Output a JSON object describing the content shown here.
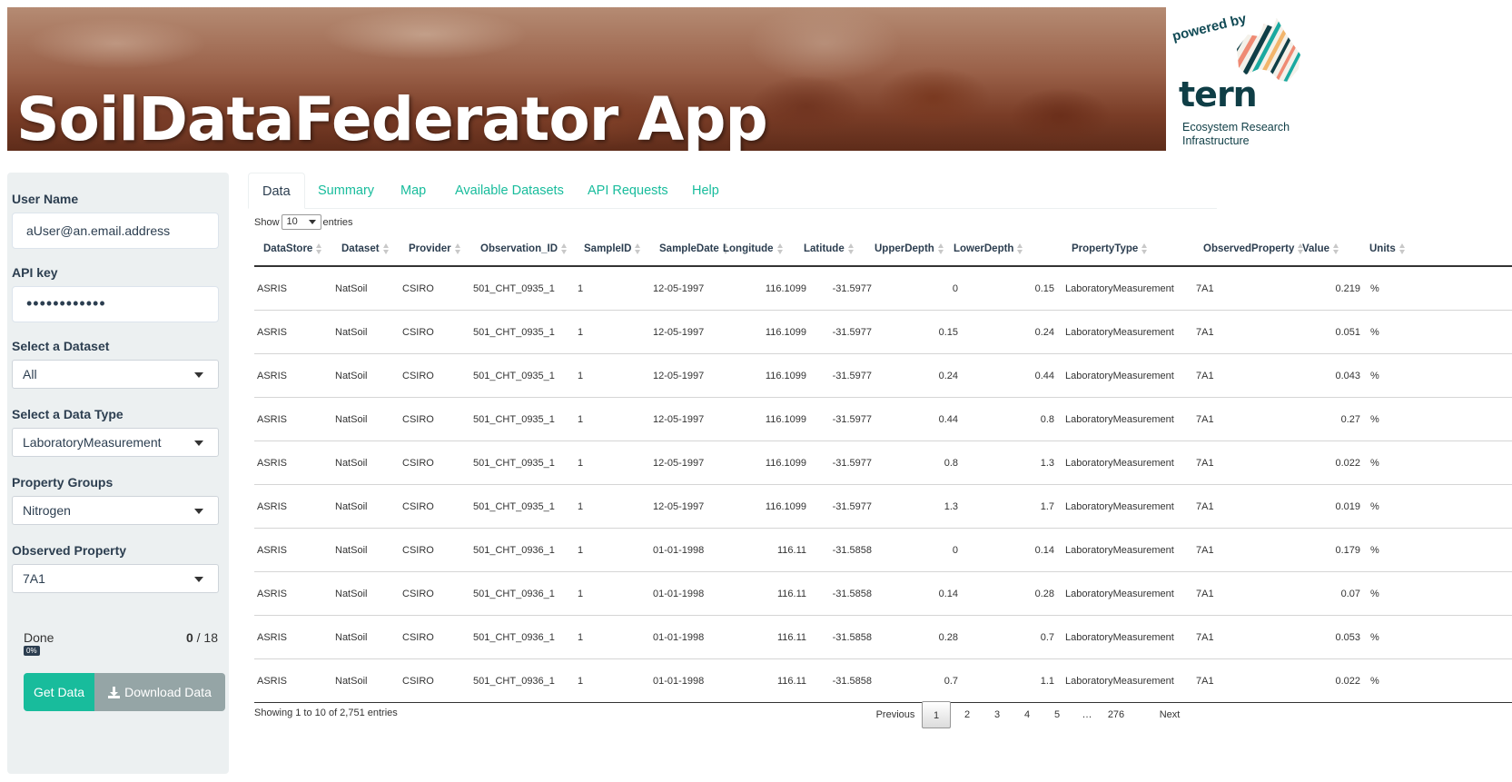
{
  "header": {
    "title": "SoilDataFederator App",
    "logo": {
      "powered_by": "powered by",
      "name": "tern",
      "subtitle_line1": "Ecosystem Research",
      "subtitle_line2": "Infrastructure"
    }
  },
  "sidebar": {
    "username_label": "User Name",
    "username_value": "aUser@an.email.address",
    "apikey_label": "API key",
    "apikey_masked": "••••••••••••",
    "dataset_label": "Select a Dataset",
    "dataset_value": "All",
    "datatype_label": "Select a Data Type",
    "datatype_value": "LaboratoryMeasurement",
    "propgroups_label": "Property Groups",
    "propgroups_value": "Nitrogen",
    "observed_label": "Observed Property",
    "observed_value": "7A1",
    "progress": {
      "label": "Done",
      "done": "0",
      "total": "/ 18",
      "percent": "0%"
    },
    "get_data_label": "Get Data",
    "download_label": "Download Data"
  },
  "tabs": [
    "Data",
    "Summary",
    "Map",
    "Available Datasets",
    "API Requests",
    "Help"
  ],
  "table_controls": {
    "show": "Show",
    "length": "10",
    "entries": "entries"
  },
  "table": {
    "columns": [
      "DataStore",
      "Dataset",
      "Provider",
      "Observation_ID",
      "SampleID",
      "SampleDate",
      "Longitude",
      "Latitude",
      "UpperDepth",
      "LowerDepth",
      "PropertyType",
      "ObservedProperty",
      "Value",
      "Units"
    ],
    "rows": [
      [
        "ASRIS",
        "NatSoil",
        "CSIRO",
        "501_CHT_0935_1",
        "1",
        "12-05-1997",
        "116.1099",
        "-31.5977",
        "0",
        "0.15",
        "LaboratoryMeasurement",
        "7A1",
        "0.219",
        "%"
      ],
      [
        "ASRIS",
        "NatSoil",
        "CSIRO",
        "501_CHT_0935_1",
        "1",
        "12-05-1997",
        "116.1099",
        "-31.5977",
        "0.15",
        "0.24",
        "LaboratoryMeasurement",
        "7A1",
        "0.051",
        "%"
      ],
      [
        "ASRIS",
        "NatSoil",
        "CSIRO",
        "501_CHT_0935_1",
        "1",
        "12-05-1997",
        "116.1099",
        "-31.5977",
        "0.24",
        "0.44",
        "LaboratoryMeasurement",
        "7A1",
        "0.043",
        "%"
      ],
      [
        "ASRIS",
        "NatSoil",
        "CSIRO",
        "501_CHT_0935_1",
        "1",
        "12-05-1997",
        "116.1099",
        "-31.5977",
        "0.44",
        "0.8",
        "LaboratoryMeasurement",
        "7A1",
        "0.27",
        "%"
      ],
      [
        "ASRIS",
        "NatSoil",
        "CSIRO",
        "501_CHT_0935_1",
        "1",
        "12-05-1997",
        "116.1099",
        "-31.5977",
        "0.8",
        "1.3",
        "LaboratoryMeasurement",
        "7A1",
        "0.022",
        "%"
      ],
      [
        "ASRIS",
        "NatSoil",
        "CSIRO",
        "501_CHT_0935_1",
        "1",
        "12-05-1997",
        "116.1099",
        "-31.5977",
        "1.3",
        "1.7",
        "LaboratoryMeasurement",
        "7A1",
        "0.019",
        "%"
      ],
      [
        "ASRIS",
        "NatSoil",
        "CSIRO",
        "501_CHT_0936_1",
        "1",
        "01-01-1998",
        "116.11",
        "-31.5858",
        "0",
        "0.14",
        "LaboratoryMeasurement",
        "7A1",
        "0.179",
        "%"
      ],
      [
        "ASRIS",
        "NatSoil",
        "CSIRO",
        "501_CHT_0936_1",
        "1",
        "01-01-1998",
        "116.11",
        "-31.5858",
        "0.14",
        "0.28",
        "LaboratoryMeasurement",
        "7A1",
        "0.07",
        "%"
      ],
      [
        "ASRIS",
        "NatSoil",
        "CSIRO",
        "501_CHT_0936_1",
        "1",
        "01-01-1998",
        "116.11",
        "-31.5858",
        "0.28",
        "0.7",
        "LaboratoryMeasurement",
        "7A1",
        "0.053",
        "%"
      ],
      [
        "ASRIS",
        "NatSoil",
        "CSIRO",
        "501_CHT_0936_1",
        "1",
        "01-01-1998",
        "116.11",
        "-31.5858",
        "0.7",
        "1.1",
        "LaboratoryMeasurement",
        "7A1",
        "0.022",
        "%"
      ]
    ],
    "info": "Showing 1 to 10 of 2,751 entries"
  },
  "pagination": {
    "previous": "Previous",
    "pages": [
      "1",
      "2",
      "3",
      "4",
      "5",
      "…",
      "276"
    ],
    "next": "Next",
    "current": "1"
  },
  "colors": {
    "primary": "#2c3e50",
    "success": "#18bc9c",
    "secondary": "#95a5a6",
    "sidebar_bg": "#ecf0f1"
  }
}
